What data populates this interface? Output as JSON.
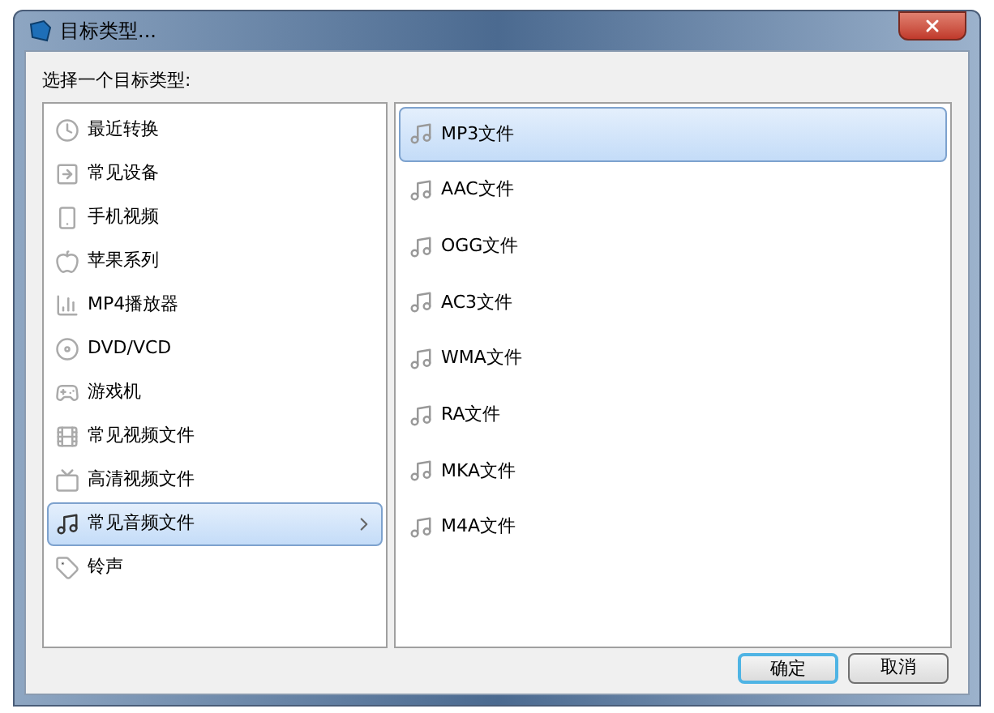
{
  "window": {
    "title": "目标类型..."
  },
  "prompt": "选择一个目标类型:",
  "categories": [
    {
      "label": "最近转换",
      "selected": false
    },
    {
      "label": "常见设备",
      "selected": false
    },
    {
      "label": "手机视频",
      "selected": false
    },
    {
      "label": "苹果系列",
      "selected": false
    },
    {
      "label": "MP4播放器",
      "selected": false
    },
    {
      "label": "DVD/VCD",
      "selected": false
    },
    {
      "label": "游戏机",
      "selected": false
    },
    {
      "label": "常见视频文件",
      "selected": false
    },
    {
      "label": "高清视频文件",
      "selected": false
    },
    {
      "label": "常见音频文件",
      "selected": true
    },
    {
      "label": "铃声",
      "selected": false
    }
  ],
  "formats": [
    {
      "label": "MP3文件",
      "selected": true
    },
    {
      "label": "AAC文件",
      "selected": false
    },
    {
      "label": "OGG文件",
      "selected": false
    },
    {
      "label": "AC3文件",
      "selected": false
    },
    {
      "label": "WMA文件",
      "selected": false
    },
    {
      "label": "RA文件",
      "selected": false
    },
    {
      "label": "MKA文件",
      "selected": false
    },
    {
      "label": "M4A文件",
      "selected": false
    }
  ],
  "buttons": [
    {
      "label": "确定",
      "kind": "default"
    },
    {
      "label": "取消",
      "kind": "normal"
    }
  ]
}
